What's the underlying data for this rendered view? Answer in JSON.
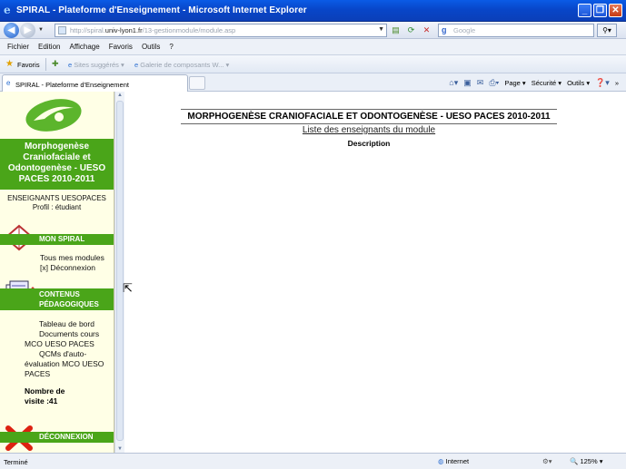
{
  "window": {
    "title": "SPIRAL - Plateforme d'Enseignement - Microsoft Internet Explorer",
    "buttons": [
      "_",
      "❐",
      "✕"
    ]
  },
  "address_bar": {
    "url_prefix": "http://spiral.",
    "url_host": "univ-lyon1.fr",
    "url_suffix": "/13-gestionmodule/module.asp",
    "search_placeholder": "Google"
  },
  "menu": {
    "items": [
      "Fichier",
      "Edition",
      "Affichage",
      "Favoris",
      "Outils",
      "?"
    ]
  },
  "favorites_bar": {
    "favorites_label": "Favoris",
    "suggested_sites": "Sites suggérés ▾",
    "gallery": "Galerie de composants W... ▾"
  },
  "tab": {
    "label": "SPIRAL - Plateforme d'Enseignement"
  },
  "command_bar": {
    "page": "Page ▾",
    "security": "Sécurité ▾",
    "tools": "Outils ▾",
    "help": "❓▾",
    "more": "»"
  },
  "sidebar": {
    "site_title": "Morphogenèse Craniofaciale et Odontogenèse - UESO PACES 2010-2011",
    "teacher_line": "ENSEIGNANTS UESOPACES",
    "profile_line": "Profil : étudiant",
    "sections": {
      "mon_spiral": {
        "header": "MON SPIRAL",
        "links": [
          "Tous mes modules",
          "[x]  Déconnexion"
        ]
      },
      "contenus": {
        "header_line1": "CONTENUS",
        "header_line2": "PÉDAGOGIQUES",
        "links": [
          "Tableau de bord",
          "Documents cours",
          "MCO UESO PACES",
          "QCMs d'auto-",
          "évaluation MCO UESO",
          "PACES"
        ]
      },
      "deconnexion": {
        "header": "DÉCONNEXION"
      }
    },
    "visits_label": "Nombre de",
    "visits_value": "visite :41"
  },
  "main": {
    "title": "MORPHOGENÈSE CRANIOFACIALE ET ODONTOGENÈSE - UESO PACES 2010-2011",
    "subtitle": "Liste des enseignants du module",
    "description": "Description"
  },
  "status_bar": {
    "status": "Terminé",
    "zone": "Internet",
    "zoom": "125%"
  },
  "colors": {
    "title_bar": "#0846c9",
    "sidebar_green": "#4aa519",
    "sidebar_bg": "#ffffe6"
  }
}
